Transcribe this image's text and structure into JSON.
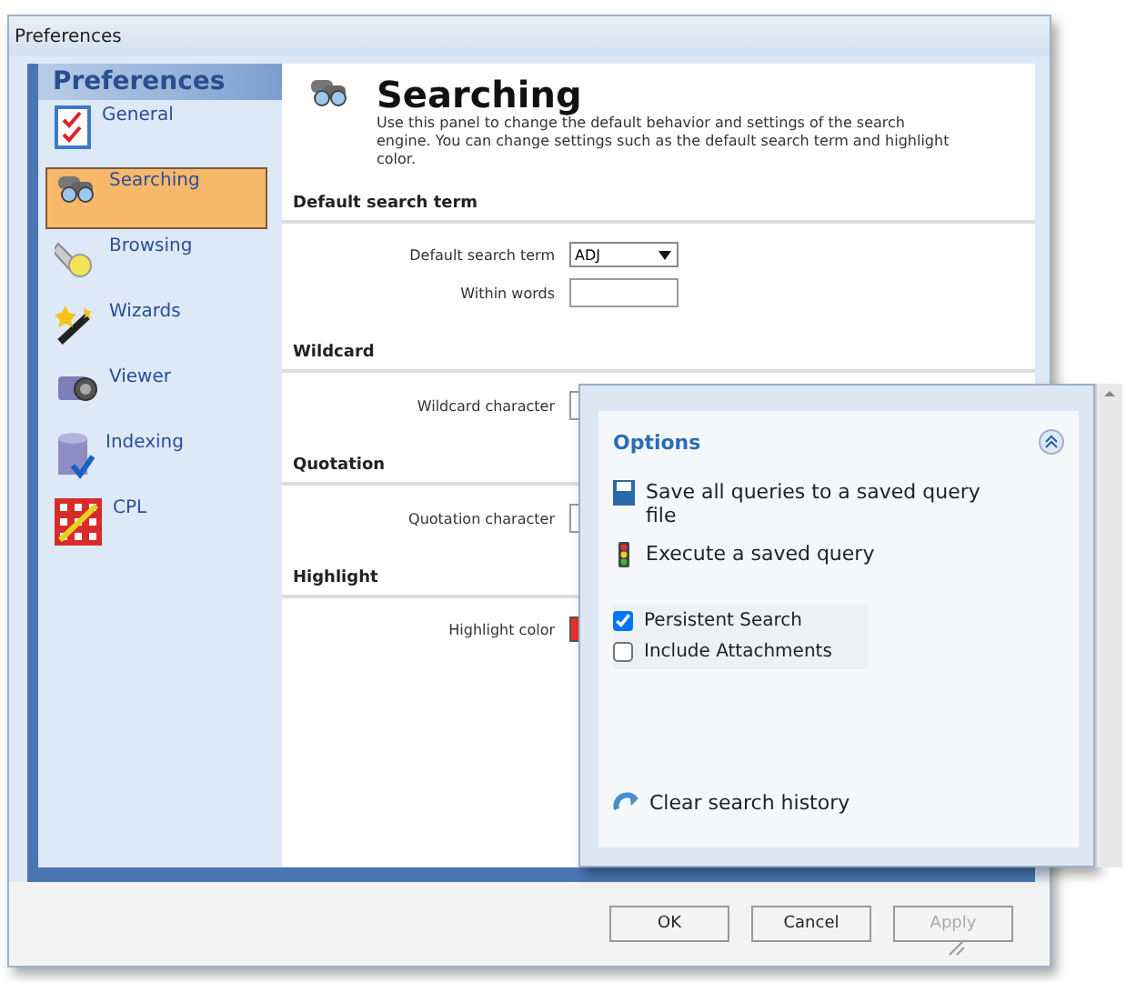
{
  "window": {
    "title": "Preferences"
  },
  "sidebar": {
    "title": "Preferences",
    "items": [
      {
        "label": "General",
        "selected": false
      },
      {
        "label": "Searching",
        "selected": true
      },
      {
        "label": "Browsing",
        "selected": false
      },
      {
        "label": "Wizards",
        "selected": false
      },
      {
        "label": "Viewer",
        "selected": false
      },
      {
        "label": "Indexing",
        "selected": false
      },
      {
        "label": "CPL",
        "selected": false
      }
    ]
  },
  "panel": {
    "title": "Searching",
    "description": "Use this panel to change the default behavior and settings of the search engine. You can change settings such as the default search term and highlight color.",
    "sections": [
      {
        "heading": "Default search term",
        "fields": [
          {
            "kind": "dropdown",
            "label": "Default search term",
            "value": "ADJ"
          },
          {
            "kind": "text",
            "label": "Within words"
          }
        ]
      },
      {
        "heading": "Wildcard",
        "fields": [
          {
            "kind": "text",
            "label": "Wildcard character"
          }
        ]
      },
      {
        "heading": "Quotation",
        "fields": [
          {
            "kind": "text",
            "label": "Quotation character"
          }
        ]
      },
      {
        "heading": "Highlight",
        "fields": [
          {
            "kind": "color",
            "label": "Highlight color",
            "color": "#e8302a"
          }
        ]
      }
    ]
  },
  "buttons": [
    {
      "label": "OK",
      "disabled": false
    },
    {
      "label": "Cancel",
      "disabled": false
    },
    {
      "label": "Apply",
      "disabled": true
    }
  ],
  "options": {
    "title": "Options",
    "actions": [
      {
        "label": "Save all queries to a saved query file"
      },
      {
        "label": "Execute a saved query"
      }
    ],
    "checks": [
      {
        "label": "Persistent Search",
        "checked": true
      },
      {
        "label": "Include Attachments",
        "checked": false
      }
    ],
    "footer": {
      "label": "Clear search history"
    }
  }
}
